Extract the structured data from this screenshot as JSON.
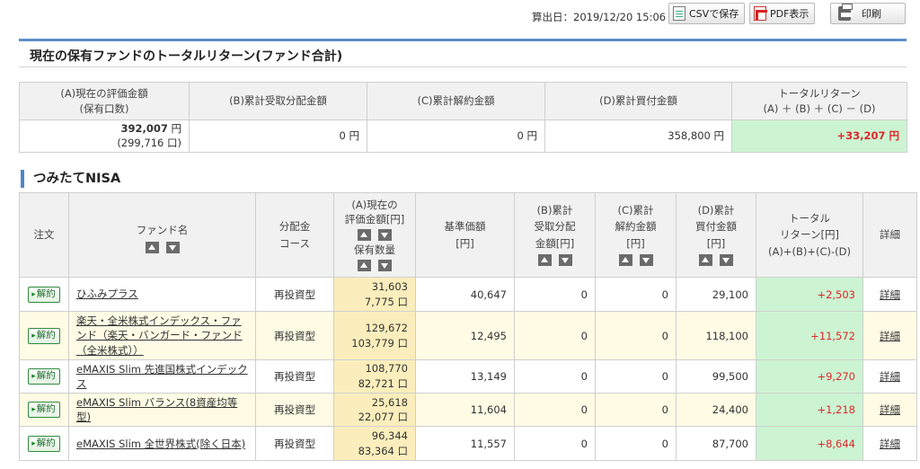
{
  "toolbar": {
    "calc_date_label": "算出日：2019/12/20 15:06",
    "csv_label": "CSVで保存",
    "pdf_label": "PDF表示",
    "print_label": "印刷"
  },
  "summary": {
    "title": "現在の保有ファンドのトータルリターン(ファンド合計)",
    "headers": {
      "a_line1": "(A)現在の評価金額",
      "a_line2": "(保有口数)",
      "b": "(B)累計受取分配金額",
      "c": "(C)累計解約金額",
      "d": "(D)累計買付金額",
      "tr_line1": "トータルリターン",
      "tr_line2": "(A) ＋ (B) ＋ (C) － (D)"
    },
    "values": {
      "a_amount": "392,007",
      "a_units": "(299,716 口)",
      "b": "0 円",
      "c": "0 円",
      "d": "358,800 円",
      "total": "+33,207 円",
      "yen": "円"
    }
  },
  "nisa": {
    "section_title": "つみたてNISA",
    "headers": {
      "order": "注文",
      "fund": "ファンド名",
      "course_1": "分配金",
      "course_2": "コース",
      "a_1": "(A)現在の",
      "a_2": "評価金額[円]",
      "a_3": "保有数量",
      "nav_1": "基準価額",
      "nav_2": "[円]",
      "b_1": "(B)累計",
      "b_2": "受取分配",
      "b_3": "金額[円]",
      "c_1": "(C)累計",
      "c_2": "解約金額",
      "c_3": "[円]",
      "d_1": "(D)累計",
      "d_2": "買付金額",
      "d_3": "[円]",
      "tr_1": "トータル",
      "tr_2": "リターン[円]",
      "tr_3": "(A)+(B)+(C)-(D)",
      "detail": "詳細"
    },
    "rows": [
      {
        "order": "解約",
        "fund": "ひふみプラス",
        "course": "再投資型",
        "amount": "31,603",
        "units": "7,775 口",
        "nav": "40,647",
        "b": "0",
        "c": "0",
        "d": "29,100",
        "ret": "+2,503",
        "detail": "詳細"
      },
      {
        "order": "解約",
        "fund": "楽天・全米株式インデックス・ファンド（楽天・バンガード・ファンド（全米株式））",
        "course": "再投資型",
        "amount": "129,672",
        "units": "103,779 口",
        "nav": "12,495",
        "b": "0",
        "c": "0",
        "d": "118,100",
        "ret": "+11,572",
        "detail": "詳細"
      },
      {
        "order": "解約",
        "fund": "eMAXIS Slim 先進国株式インデックス",
        "course": "再投資型",
        "amount": "108,770",
        "units": "82,721 口",
        "nav": "13,149",
        "b": "0",
        "c": "0",
        "d": "99,500",
        "ret": "+9,270",
        "detail": "詳細"
      },
      {
        "order": "解約",
        "fund": "eMAXIS Slim バランス(8資産均等型)",
        "course": "再投資型",
        "amount": "25,618",
        "units": "22,077 口",
        "nav": "11,604",
        "b": "0",
        "c": "0",
        "d": "24,400",
        "ret": "+1,218",
        "detail": "詳細"
      },
      {
        "order": "解約",
        "fund": "eMAXIS Slim 全世界株式(除く日本)",
        "course": "再投資型",
        "amount": "96,344",
        "units": "83,364 口",
        "nav": "11,557",
        "b": "0",
        "c": "0",
        "d": "87,700",
        "ret": "+8,644",
        "detail": "詳細"
      }
    ]
  },
  "colors": {
    "accent_blue": "#5b8fc7",
    "return_green_bg": "#ccf4d2",
    "return_red_text": "#e0262a",
    "valuation_yellow_bg": "#fbeebc",
    "alt_row_bg": "#fffbe4"
  },
  "icons": {
    "csv": "csv-file-icon",
    "pdf": "pdf-file-icon",
    "print": "printer-icon",
    "sort_up": "sort-asc-icon",
    "sort_down": "sort-desc-icon"
  }
}
